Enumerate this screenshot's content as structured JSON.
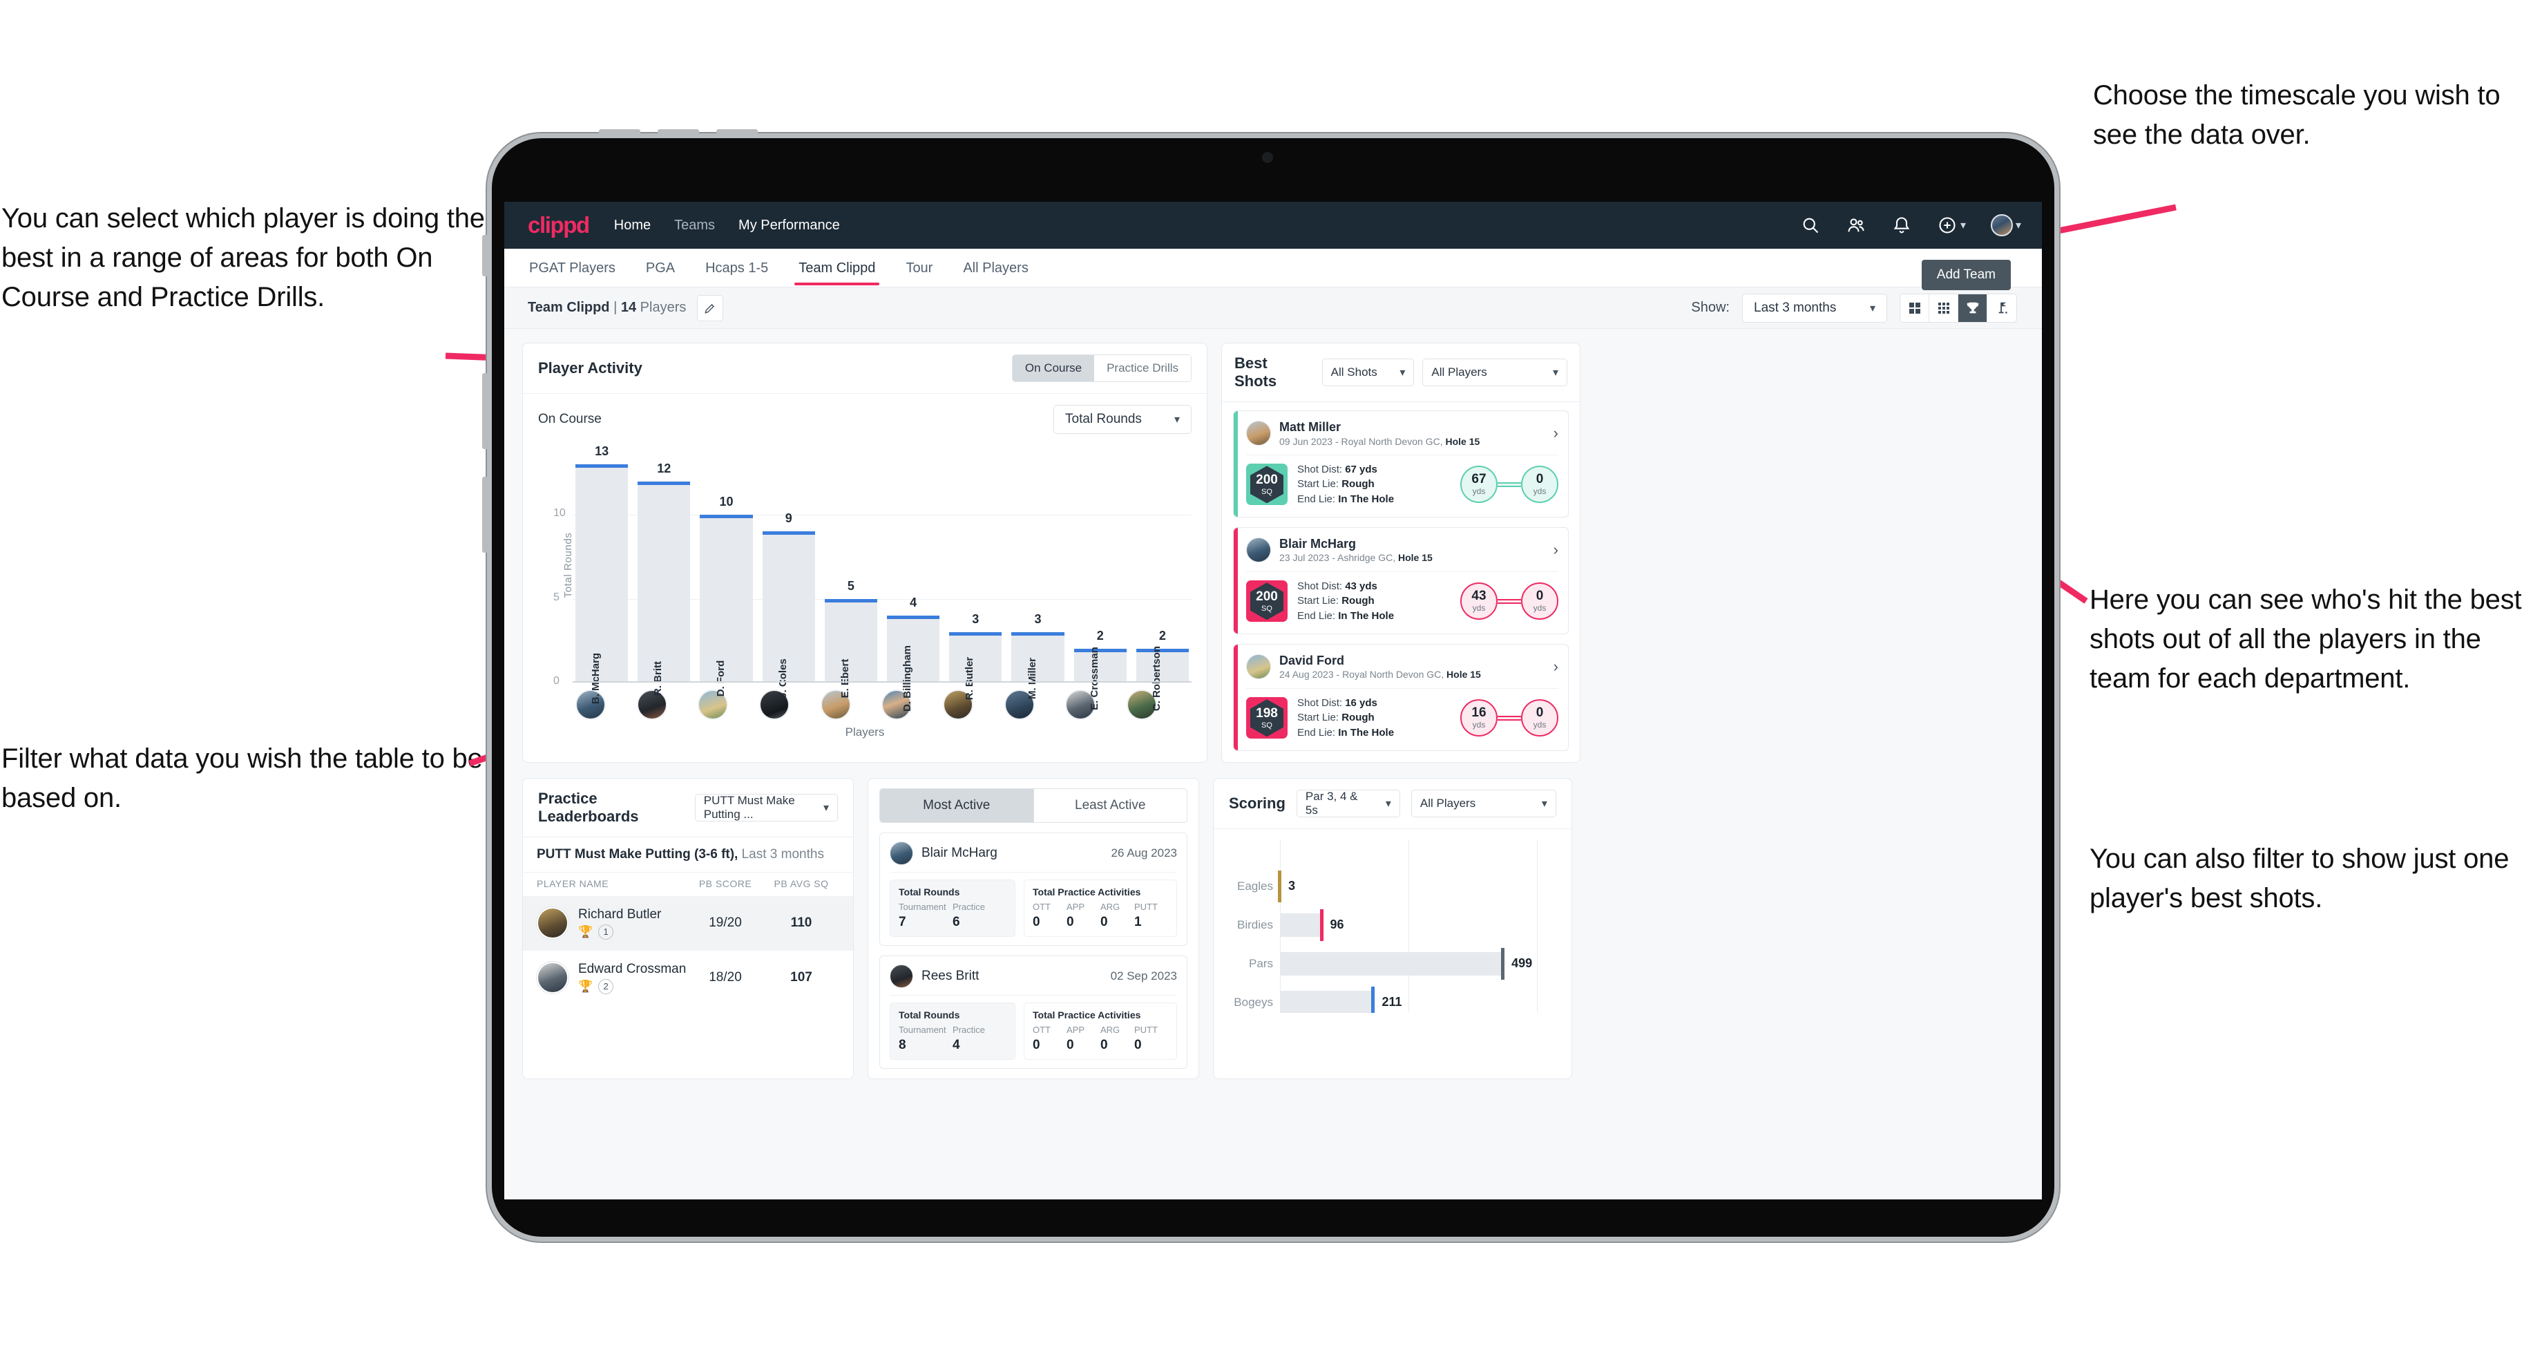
{
  "annotations": {
    "left_top": "You can select which player is doing the best in a range of areas for both On Course and Practice Drills.",
    "left_bottom": "Filter what data you wish the table to be based on.",
    "right_top": "Choose the timescale you wish to see the data over.",
    "right_middle": "Here you can see who's hit the best shots out of all the players in the team for each department.",
    "right_bottom": "You can also filter to show just one player's best shots."
  },
  "topnav": {
    "brand": "clippd",
    "links": [
      {
        "label": "Home",
        "active": true
      },
      {
        "label": "Teams",
        "active": false
      },
      {
        "label": "My Performance",
        "active": true
      }
    ],
    "icons": [
      "search-icon",
      "people-icon",
      "bell-icon",
      "plus-circle-icon",
      "user-avatar"
    ]
  },
  "tabs": [
    {
      "label": "PGAT Players",
      "active": false
    },
    {
      "label": "PGA",
      "active": false
    },
    {
      "label": "Hcaps 1-5",
      "active": false
    },
    {
      "label": "Team Clippd",
      "active": true
    },
    {
      "label": "Tour",
      "active": false
    },
    {
      "label": "All Players",
      "active": false
    }
  ],
  "tooltip": {
    "add_team": "Add Team"
  },
  "subbar": {
    "team_name": "Team Clippd",
    "separator": "|",
    "player_count": "14",
    "players_word": "Players",
    "edit_icon": "pencil-icon",
    "show_label": "Show:",
    "timescale_value": "Last 3 months",
    "view_modes": [
      {
        "name": "grid-2x2-icon",
        "active": false
      },
      {
        "name": "grid-3x3-icon",
        "active": false
      },
      {
        "name": "trophy-icon",
        "active": true
      },
      {
        "name": "golf-flag-icon",
        "active": false
      }
    ]
  },
  "player_activity": {
    "title": "Player Activity",
    "segments": [
      {
        "label": "On Course",
        "active": true
      },
      {
        "label": "Practice Drills",
        "active": false
      }
    ],
    "sub_label": "On Course",
    "metric_select": "Total Rounds"
  },
  "best_shots": {
    "title": "Best Shots",
    "shot_filter": "All Shots",
    "player_filter": "All Players",
    "shots": [
      {
        "player": "Matt Miller",
        "meta_date": "09 Jun 2023 - Royal North Devon GC,",
        "meta_hole": "Hole 15",
        "score": "200",
        "score_unit": "SQ",
        "accent": "#5ccfb0",
        "shot_dist_label": "Shot Dist:",
        "shot_dist": "67 yds",
        "start_lie_label": "Start Lie:",
        "start_lie": "Rough",
        "end_lie_label": "End Lie:",
        "end_lie": "In The Hole",
        "from_value": "67",
        "from_unit": "yds",
        "to_value": "0",
        "to_unit": "yds",
        "chevron": "chevron-right-icon"
      },
      {
        "player": "Blair McHarg",
        "meta_date": "23 Jul 2023 - Ashridge GC,",
        "meta_hole": "Hole 15",
        "score": "200",
        "score_unit": "SQ",
        "accent": "#ef2a63",
        "shot_dist_label": "Shot Dist:",
        "shot_dist": "43 yds",
        "start_lie_label": "Start Lie:",
        "start_lie": "Rough",
        "end_lie_label": "End Lie:",
        "end_lie": "In The Hole",
        "from_value": "43",
        "from_unit": "yds",
        "to_value": "0",
        "to_unit": "yds",
        "chevron": "chevron-right-icon"
      },
      {
        "player": "David Ford",
        "meta_date": "24 Aug 2023 - Royal North Devon GC,",
        "meta_hole": "Hole 15",
        "score": "198",
        "score_unit": "SQ",
        "accent": "#ef2a63",
        "shot_dist_label": "Shot Dist:",
        "shot_dist": "16 yds",
        "start_lie_label": "Start Lie:",
        "start_lie": "Rough",
        "end_lie_label": "End Lie:",
        "end_lie": "In The Hole",
        "from_value": "16",
        "from_unit": "yds",
        "to_value": "0",
        "to_unit": "yds",
        "chevron": "chevron-right-icon"
      }
    ]
  },
  "practice_leaderboards": {
    "title": "Practice Leaderboards",
    "drill_select": "PUTT Must Make Putting ...",
    "subtitle_bold": "PUTT Must Make Putting (3-6 ft),",
    "subtitle_dim": "Last 3 months",
    "columns": [
      "PLAYER NAME",
      "PB SCORE",
      "PB AVG SQ"
    ],
    "rows": [
      {
        "name": "Richard Butler",
        "rank": "1",
        "trophy": "gold",
        "pb_score": "19/20",
        "pb_avg_sq": "110"
      },
      {
        "name": "Edward Crossman",
        "rank": "2",
        "trophy": "silver",
        "pb_score": "18/20",
        "pb_avg_sq": "107"
      }
    ]
  },
  "activity_panel": {
    "tabs": [
      {
        "label": "Most Active",
        "active": true
      },
      {
        "label": "Least Active",
        "active": false
      }
    ],
    "rounds_title": "Total Rounds",
    "rounds_cols": [
      "Tournament",
      "Practice"
    ],
    "practice_title": "Total Practice Activities",
    "practice_cols": [
      "OTT",
      "APP",
      "ARG",
      "PUTT"
    ],
    "cards": [
      {
        "name": "Blair McHarg",
        "date": "26 Aug 2023",
        "tournament": "7",
        "practice": "6",
        "ott": "0",
        "app": "0",
        "arg": "0",
        "putt": "1"
      },
      {
        "name": "Rees Britt",
        "date": "02 Sep 2023",
        "tournament": "8",
        "practice": "4",
        "ott": "0",
        "app": "0",
        "arg": "0",
        "putt": "0"
      }
    ]
  },
  "scoring": {
    "title": "Scoring",
    "par_select": "Par 3, 4 & 5s",
    "player_select": "All Players"
  },
  "colors": {
    "brand_pink": "#ef2a63",
    "nav_dark": "#1c2a35",
    "bar_blue": "#3b7ddd",
    "teal": "#5ccfb0",
    "gold": "#b8923f"
  },
  "chart_data": [
    {
      "type": "bar",
      "title": "Player Activity - On Course",
      "xlabel": "Players",
      "ylabel": "Total Rounds",
      "ylim": [
        0,
        14
      ],
      "yticks": [
        0,
        5,
        10
      ],
      "grid": true,
      "categories": [
        "B. McHarg",
        "R. Britt",
        "D. Ford",
        "J. Coles",
        "E. Ebert",
        "D. Billingham",
        "R. Butler",
        "M. Miller",
        "E. Crossman",
        "C. Robertson"
      ],
      "values": [
        13,
        12,
        10,
        9,
        5,
        4,
        3,
        3,
        2,
        2
      ],
      "series": [
        {
          "name": "Total Rounds",
          "values": [
            13,
            12,
            10,
            9,
            5,
            4,
            3,
            3,
            2,
            2
          ]
        }
      ]
    },
    {
      "type": "bar",
      "orientation": "horizontal",
      "title": "Scoring",
      "xlabel": "",
      "ylabel": "",
      "xlim": [
        0,
        620
      ],
      "grid": true,
      "categories": [
        "Eagles",
        "Birdies",
        "Pars",
        "Bogeys"
      ],
      "values": [
        3,
        96,
        499,
        211
      ],
      "bar_colors": [
        "#b8923f",
        "#ef2a63",
        "#5b6770",
        "#3b7ddd"
      ]
    }
  ]
}
